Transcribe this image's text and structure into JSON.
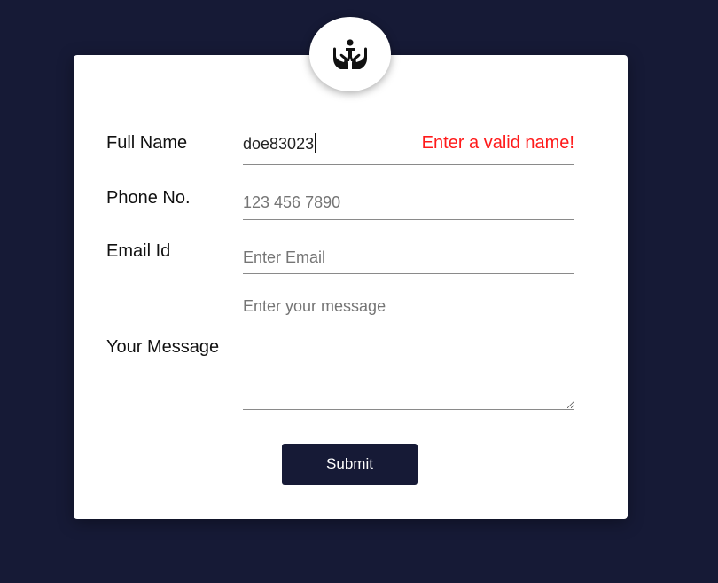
{
  "logo": {
    "icon": "hands-holding-person-icon"
  },
  "form": {
    "full_name": {
      "label": "Full Name",
      "value": "doe83023",
      "error": "Enter a valid name!"
    },
    "phone": {
      "label": "Phone No.",
      "placeholder": "123 456 7890"
    },
    "email": {
      "label": "Email Id",
      "placeholder": "Enter Email"
    },
    "message": {
      "label": "Your Message",
      "placeholder": "Enter your message"
    },
    "submit_label": "Submit"
  },
  "colors": {
    "background": "#161a36",
    "card": "#ffffff",
    "error": "#ff1a1a",
    "button": "#161a36"
  }
}
